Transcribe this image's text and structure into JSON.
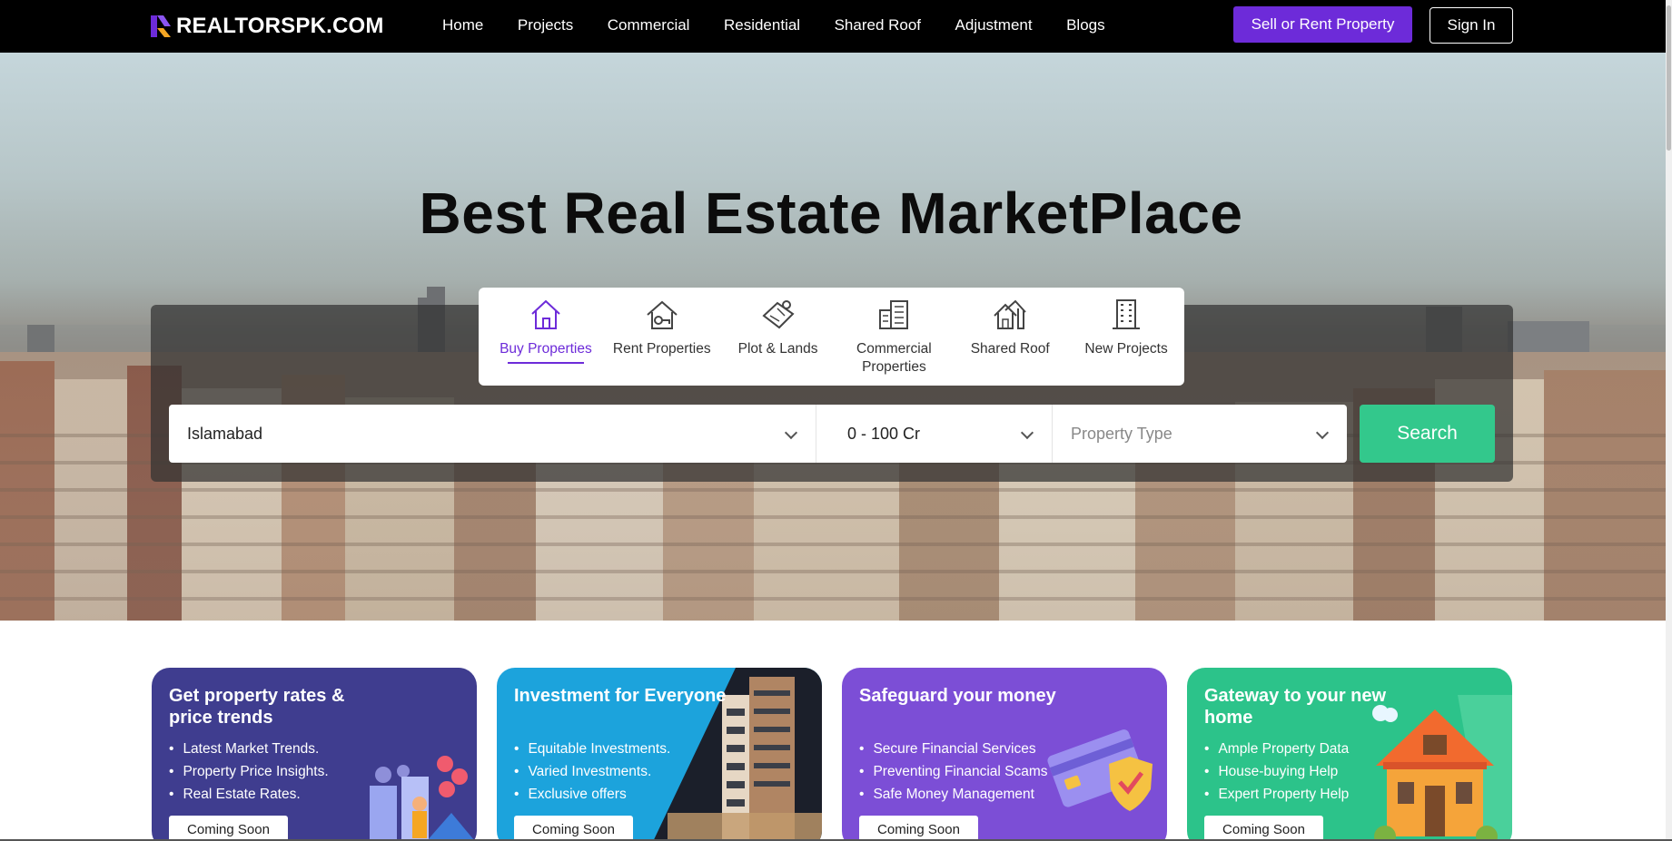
{
  "brand": {
    "name": "REALTORSPK.COM",
    "accent": "#6d2bd9"
  },
  "nav": {
    "items": [
      "Home",
      "Projects",
      "Commercial",
      "Residential",
      "Shared Roof",
      "Adjustment",
      "Blogs"
    ],
    "sell_label": "Sell or Rent Property",
    "signin_label": "Sign In"
  },
  "hero": {
    "title": "Best Real Estate MarketPlace",
    "tabs": [
      {
        "label": "Buy Properties",
        "icon": "house-icon",
        "active": true
      },
      {
        "label": "Rent Properties",
        "icon": "rent-house-icon",
        "active": false
      },
      {
        "label": "Plot & Lands",
        "icon": "plot-map-icon",
        "active": false
      },
      {
        "label": "Commercial Properties",
        "icon": "commercial-building-icon",
        "active": false
      },
      {
        "label": "Shared Roof",
        "icon": "shared-roof-icon",
        "active": false
      },
      {
        "label": "New Projects",
        "icon": "tower-building-icon",
        "active": false
      }
    ],
    "search": {
      "city": "Islamabad",
      "price_range": "0 - 100 Cr",
      "property_type_placeholder": "Property Type",
      "button": "Search",
      "button_color": "#33c88c"
    }
  },
  "cards": [
    {
      "title": "Get property rates & price trends",
      "color": "#3f3d8f",
      "items": [
        "Latest Market Trends.",
        "Property Price Insights.",
        "Real Estate Rates."
      ],
      "button": "Coming Soon"
    },
    {
      "title": "Investment for Everyone",
      "color": "#1ca3dc",
      "items": [
        "Equitable Investments.",
        "Varied Investments.",
        "Exclusive offers"
      ],
      "button": "Coming Soon"
    },
    {
      "title": "Safeguard your money",
      "color": "#7c4ed6",
      "items": [
        "Secure Financial Services",
        "Preventing Financial Scams",
        "Safe Money Management"
      ],
      "button": "Coming Soon"
    },
    {
      "title": "Gateway to your new home",
      "color": "#2cc38a",
      "items": [
        "Ample Property Data",
        "House-buying Help",
        "Expert Property Help"
      ],
      "button": "Coming Soon"
    }
  ]
}
